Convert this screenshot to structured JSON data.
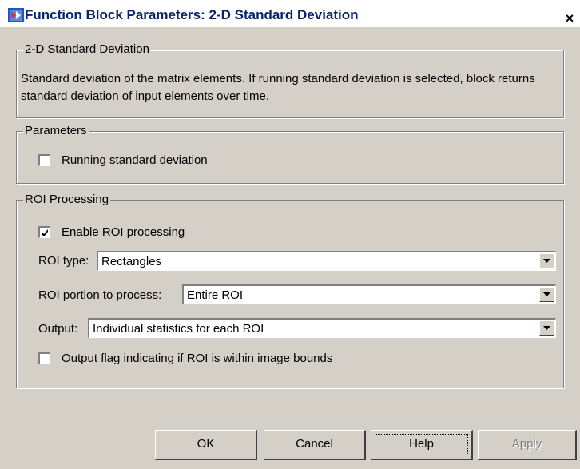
{
  "window": {
    "title": "Function Block Parameters: 2-D Standard Deviation",
    "close_glyph": "×"
  },
  "description_group": {
    "legend": "2-D Standard Deviation",
    "text": "Standard deviation of the matrix elements. If running standard deviation is selected, block returns standard deviation of input elements over time."
  },
  "parameters_group": {
    "legend": "Parameters",
    "running_std": {
      "label": "Running standard deviation",
      "checked": false
    }
  },
  "roi_group": {
    "legend": "ROI Processing",
    "enable_roi": {
      "label": "Enable ROI processing",
      "checked": true
    },
    "roi_type": {
      "label": "ROI type:",
      "value": "Rectangles"
    },
    "roi_portion": {
      "label": "ROI portion to process:",
      "value": "Entire ROI"
    },
    "output": {
      "label": "Output:",
      "value": "Individual statistics for each ROI"
    },
    "output_flag": {
      "label": "Output flag indicating if ROI is within image bounds",
      "checked": false
    }
  },
  "buttons": {
    "ok": "OK",
    "cancel": "Cancel",
    "help": "Help",
    "apply": "Apply"
  },
  "colors": {
    "dialog_bg": "#d4d0c8",
    "title_text": "#0a246a"
  }
}
